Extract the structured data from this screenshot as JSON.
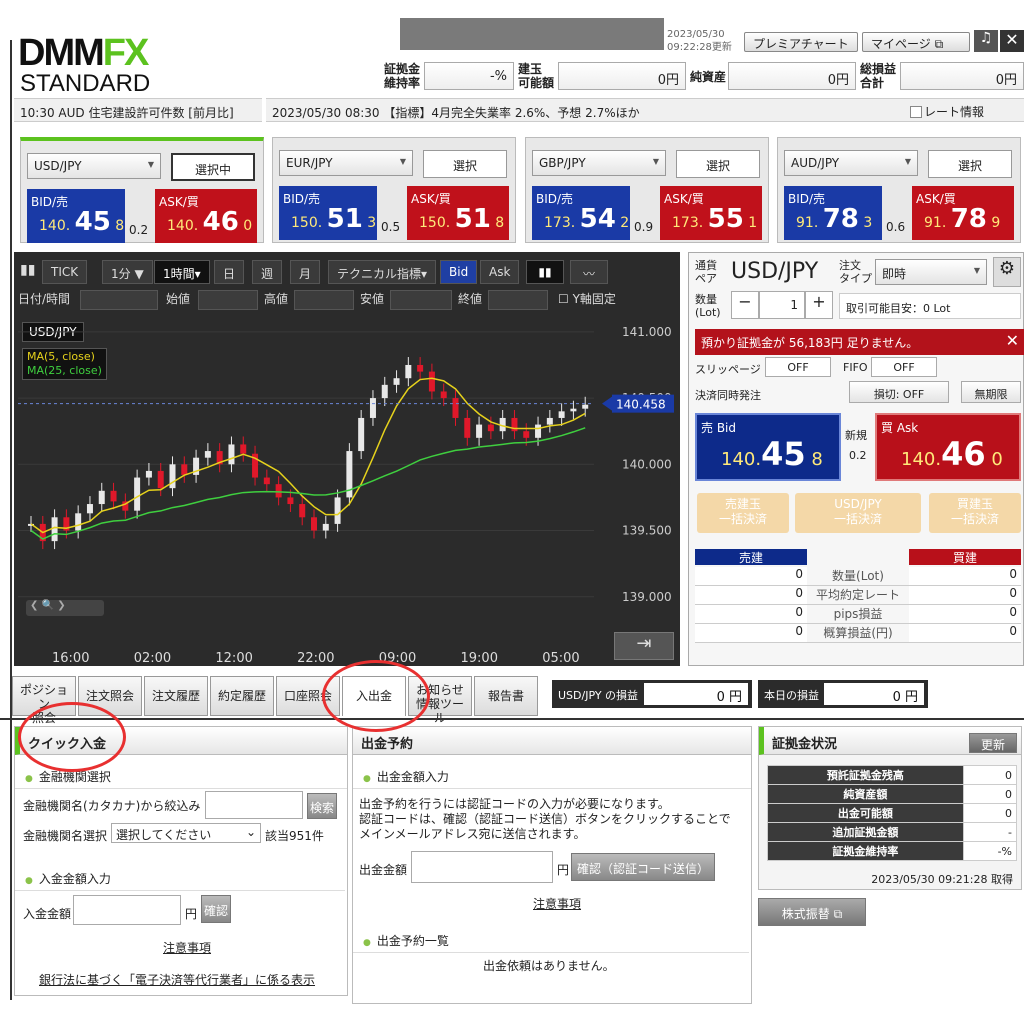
{
  "header": {
    "logo_main": "DMM",
    "logo_fx": "FX",
    "logo_sub": "STANDARD",
    "timestamp_top": "2023/05/30",
    "timestamp": "09:22:28更新",
    "premium_chart": "プレミアチャート",
    "mypage": "マイページ"
  },
  "stats": [
    {
      "label": "証拠金\n維持率",
      "value": "-%"
    },
    {
      "label": "建玉\n可能額",
      "value": "0円"
    },
    {
      "label": "純資産",
      "value": "0円"
    },
    {
      "label": "総損益\n合計",
      "value": "0円"
    }
  ],
  "ticker": {
    "left": "10:30 AUD 住宅建設許可件数 [前月比]",
    "news": "2023/05/30 08:30 【指標】4月完全失業率 2.6%、予想 2.7%ほか",
    "rate_info": "レート情報"
  },
  "pairs": [
    {
      "pair": "USD/JPY",
      "btn": "選択中",
      "bid_label": "BID/売",
      "ask_label": "ASK/買",
      "bid_small": "140.",
      "bid_big": "45",
      "bid_pip": "8",
      "spread": "0.2",
      "ask_small": "140.",
      "ask_big": "46",
      "ask_pip": "0"
    },
    {
      "pair": "EUR/JPY",
      "btn": "選択",
      "bid_label": "BID/売",
      "ask_label": "ASK/買",
      "bid_small": "150.",
      "bid_big": "51",
      "bid_pip": "3",
      "spread": "0.5",
      "ask_small": "150.",
      "ask_big": "51",
      "ask_pip": "8"
    },
    {
      "pair": "GBP/JPY",
      "btn": "選択",
      "bid_label": "BID/売",
      "ask_label": "ASK/買",
      "bid_small": "173.",
      "bid_big": "54",
      "bid_pip": "2",
      "spread": "0.9",
      "ask_small": "173.",
      "ask_big": "55",
      "ask_pip": "1"
    },
    {
      "pair": "AUD/JPY",
      "btn": "選択",
      "bid_label": "BID/売",
      "ask_label": "ASK/買",
      "bid_small": "91.",
      "bid_big": "78",
      "bid_pip": "3",
      "spread": "0.6",
      "ask_small": "91.",
      "ask_big": "78",
      "ask_pip": "9"
    }
  ],
  "chart_toolbar": {
    "tick": "TICK",
    "min": "1分 ▼",
    "hour": "1時間▾",
    "day": "日",
    "week": "週",
    "month": "月",
    "tech": "テクニカル指標▾",
    "bid": "Bid",
    "ask": "Ask"
  },
  "chart_fields": {
    "datetime": "日付/時間",
    "open": "始値",
    "high": "高値",
    "low": "安値",
    "close": "終値",
    "yfix": "Y軸固定"
  },
  "chart_data": {
    "type": "line",
    "title": "USD/JPY",
    "legend": [
      "MA(5, close)",
      "MA(25, close)"
    ],
    "series_colors": {
      "ma5": "#e6d21c",
      "ma25": "#3fcf3f"
    },
    "y_ticks": [
      "141.000",
      "140.500",
      "140.000",
      "139.500",
      "139.000"
    ],
    "ylim": [
      138.9,
      141.15
    ],
    "x_ticks": [
      "16:00",
      "02:00",
      "12:00",
      "22:00",
      "09:00",
      "19:00",
      "05:00"
    ],
    "current_price": "140.458",
    "close_values": [
      139.55,
      139.42,
      139.6,
      139.5,
      139.63,
      139.7,
      139.8,
      139.72,
      139.65,
      139.9,
      139.95,
      139.82,
      140.0,
      139.92,
      140.05,
      140.1,
      140.0,
      140.15,
      140.08,
      139.9,
      139.85,
      139.75,
      139.7,
      139.6,
      139.5,
      139.55,
      139.75,
      140.1,
      140.35,
      140.5,
      140.6,
      140.65,
      140.75,
      140.7,
      140.55,
      140.5,
      140.35,
      140.2,
      140.3,
      140.25,
      140.35,
      140.25,
      140.2,
      140.3,
      140.35,
      140.4,
      140.42,
      140.45
    ]
  },
  "order_panel": {
    "pair_label": "通貨\nペア",
    "pair": "USD/JPY",
    "type_label": "注文\nタイプ",
    "type_value": "即時",
    "qty_label": "数量\n(Lot)",
    "qty": "1",
    "avail": "取引可能目安：0 Lot",
    "warning": "預かり証拠金が 56,183円 足りません。",
    "slippage_label": "スリッページ",
    "slippage": "OFF",
    "fifo_label": "FIFO",
    "fifo": "OFF",
    "settle_label": "決済同時発注",
    "stop": "損切: OFF",
    "expiry": "無期限",
    "sell_label": "売 Bid",
    "sell_small": "140.",
    "sell_big": "45",
    "sell_pip": "8",
    "new_label": "新規",
    "spread": "0.2",
    "buy_label": "買 Ask",
    "buy_small": "140.",
    "buy_big": "46",
    "buy_pip": "0",
    "btn_sell_all": "売建玉\n一括決済",
    "btn_pair_all": "USD/JPY\n一括決済",
    "btn_buy_all": "買建玉\n一括決済",
    "sell_head": "売建",
    "buy_head": "買建",
    "rows": [
      {
        "label": "数量(Lot)",
        "sell": "0",
        "buy": "0"
      },
      {
        "label": "平均約定レート",
        "sell": "0",
        "buy": "0"
      },
      {
        "label": "pips損益",
        "sell": "0",
        "buy": "0"
      },
      {
        "label": "概算損益(円)",
        "sell": "0",
        "buy": "0"
      }
    ]
  },
  "tabs": [
    "ポジション\n照会",
    "注文照会",
    "注文履歴",
    "約定履歴",
    "口座照会",
    "入出金",
    "お知らせ\n情報ツール",
    "報告書"
  ],
  "pnl": {
    "usd_label": "USD/JPY の損益",
    "usd_value": "0 円",
    "today_label": "本日の損益",
    "today_value": "0 円"
  },
  "quick": {
    "title": "クイック入金",
    "sub1": "金融機関選択",
    "filter_label": "金融機関名(カタカナ)から絞込み",
    "search": "検索",
    "select_label": "金融機関名選択",
    "select_value": "選択してください",
    "count": "該当951件",
    "sub2": "入金金額入力",
    "amount_label": "入金金額",
    "yen": "円",
    "confirm": "確認",
    "notes": "注意事項",
    "footer": "銀行法に基づく「電子決済等代行業者」に係る表示"
  },
  "withdraw": {
    "title": "出金予約",
    "sub1": "出金金額入力",
    "desc1": "出金予約を行うには認証コードの入力が必要になります。",
    "desc2": "認証コードは、確認（認証コード送信）ボタンをクリックすることで",
    "desc3": "メインメールアドレス宛に送信されます。",
    "amount_label": "出金金額",
    "yen": "円",
    "confirm": "確認（認証コード送信）",
    "notes": "注意事項",
    "sub2": "出金予約一覧",
    "empty": "出金依頼はありません。"
  },
  "margin": {
    "title": "証拠金状況",
    "refresh": "更新",
    "rows": [
      {
        "label": "預託証拠金残高",
        "value": "0"
      },
      {
        "label": "純資産額",
        "value": "0"
      },
      {
        "label": "出金可能額",
        "value": "0"
      },
      {
        "label": "追加証拠金額",
        "value": "-"
      },
      {
        "label": "証拠金維持率",
        "value": "-%"
      }
    ],
    "time": "2023/05/30 09:21:28 取得",
    "stock_transfer": "株式振替"
  }
}
